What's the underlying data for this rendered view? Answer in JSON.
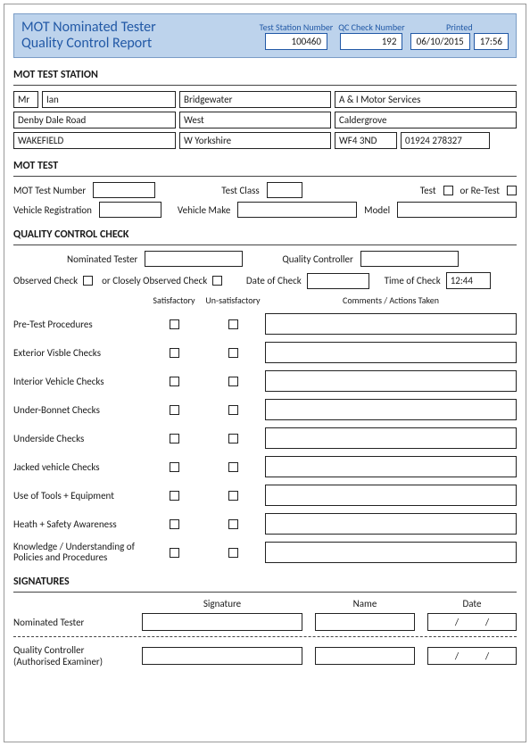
{
  "header": {
    "title_line1": "MOT Nominated Tester",
    "title_line2": "Quality Control Report",
    "test_station_label": "Test Station Number",
    "test_station_value": "100460",
    "qc_check_label": "QC Check Number",
    "qc_check_value": "192",
    "printed_label": "Printed",
    "printed_date": "06/10/2015",
    "printed_time": "17:56"
  },
  "station": {
    "section_title": "MOT TEST STATION",
    "title": "Mr",
    "first_name": "Ian",
    "surname": "Bridgewater",
    "company": "A & I Motor Services",
    "address1": "Denby Dale Road",
    "area": "West",
    "locality": "Caldergrove",
    "town": "WAKEFIELD",
    "county": "W Yorkshire",
    "postcode": "WF4 3ND",
    "phone": "01924 278327"
  },
  "mottest": {
    "section_title": "MOT TEST",
    "test_number_label": "MOT Test Number",
    "test_number": "",
    "test_class_label": "Test Class",
    "test_class": "",
    "test_label": "Test",
    "or_retest_label": "or Re-Test",
    "vehicle_reg_label": "Vehicle Registration",
    "vehicle_reg": "",
    "vehicle_make_label": "Vehicle Make",
    "vehicle_make": "",
    "model_label": "Model",
    "model": ""
  },
  "qc": {
    "section_title": "QUALITY CONTROL CHECK",
    "nominated_tester_label": "Nominated Tester",
    "nominated_tester": "",
    "quality_controller_label": "Quality Controller",
    "quality_controller": "",
    "observed_check_label": "Observed Check",
    "closely_observed_label": "or Closely Observed Check",
    "date_of_check_label": "Date of Check",
    "date_of_check": "",
    "time_of_check_label": "Time of Check",
    "time_of_check": "12:44",
    "col_satisfactory": "Satisfactory",
    "col_unsatisfactory": "Un-satisfactory",
    "col_comments": "Comments / Actions Taken",
    "items": [
      "Pre-Test Procedures",
      "Exterior Visble Checks",
      "Interior Vehicle Checks",
      "Under-Bonnet Checks",
      "Underside Checks",
      "Jacked vehicle Checks",
      "Use of Tools + Equipment",
      "Heath + Safety Awareness",
      "Knowledge / Understanding of Policies and Procedures"
    ]
  },
  "signatures": {
    "section_title": "SIGNATURES",
    "col_signature": "Signature",
    "col_name": "Name",
    "col_date": "Date",
    "nominated_tester_label": "Nominated Tester",
    "quality_controller_label1": "Quality Controller",
    "quality_controller_label2": "(Authorised Examiner)",
    "slash": "/"
  }
}
